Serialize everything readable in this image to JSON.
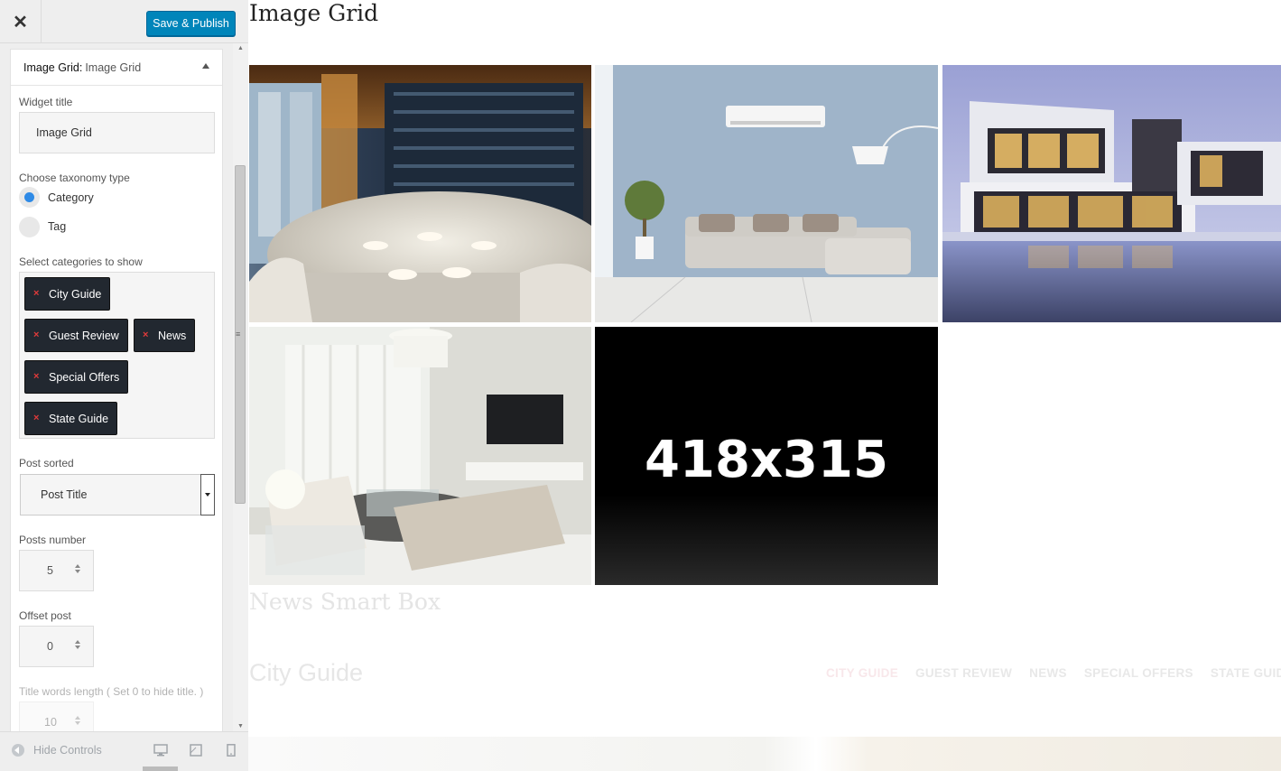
{
  "header": {
    "close_glyph": "✕",
    "publish_label": "Save & Publish"
  },
  "widget": {
    "title_prefix": "Image Grid:",
    "title_name": "Image Grid",
    "fields": {
      "widget_title_label": "Widget title",
      "widget_title_value": "Image Grid",
      "taxonomy_label": "Choose taxonomy type",
      "taxonomy_options": [
        "Category",
        "Tag"
      ],
      "taxonomy_selected": "Category",
      "categories_label": "Select categories to show",
      "categories": [
        "City Guide",
        "Guest Review",
        "News",
        "Special Offers",
        "State Guide"
      ],
      "remove_glyph": "×",
      "post_sorted_label": "Post sorted",
      "post_sorted_value": "Post Title",
      "posts_number_label": "Posts number",
      "posts_number_value": "5",
      "offset_label": "Offset post",
      "offset_value": "0",
      "title_words_label": "Title words length ( Set 0 to hide title. )",
      "title_words_value": "10"
    }
  },
  "footer": {
    "hide_controls": "Hide Controls",
    "devices": [
      "desktop-icon",
      "tablet-icon",
      "mobile-icon"
    ]
  },
  "preview": {
    "heading": "Image Grid",
    "placeholder_text": "418x315",
    "section2_title": "News Smart Box",
    "section3_title": "City Guide",
    "tabs": [
      "CITY GUIDE",
      "GUEST REVIEW",
      "NEWS",
      "SPECIAL OFFERS",
      "STATE GUIDE"
    ],
    "images": [
      "restaurant-dining-room",
      "living-room-grey-sofa",
      "modern-villa-pool",
      "living-room-tv",
      "placeholder-418x315"
    ]
  },
  "colors": {
    "accent": "#0085ba",
    "radio": "#2e8ae6",
    "chip_bg": "#222830",
    "chip_x": "#e23b3b"
  }
}
